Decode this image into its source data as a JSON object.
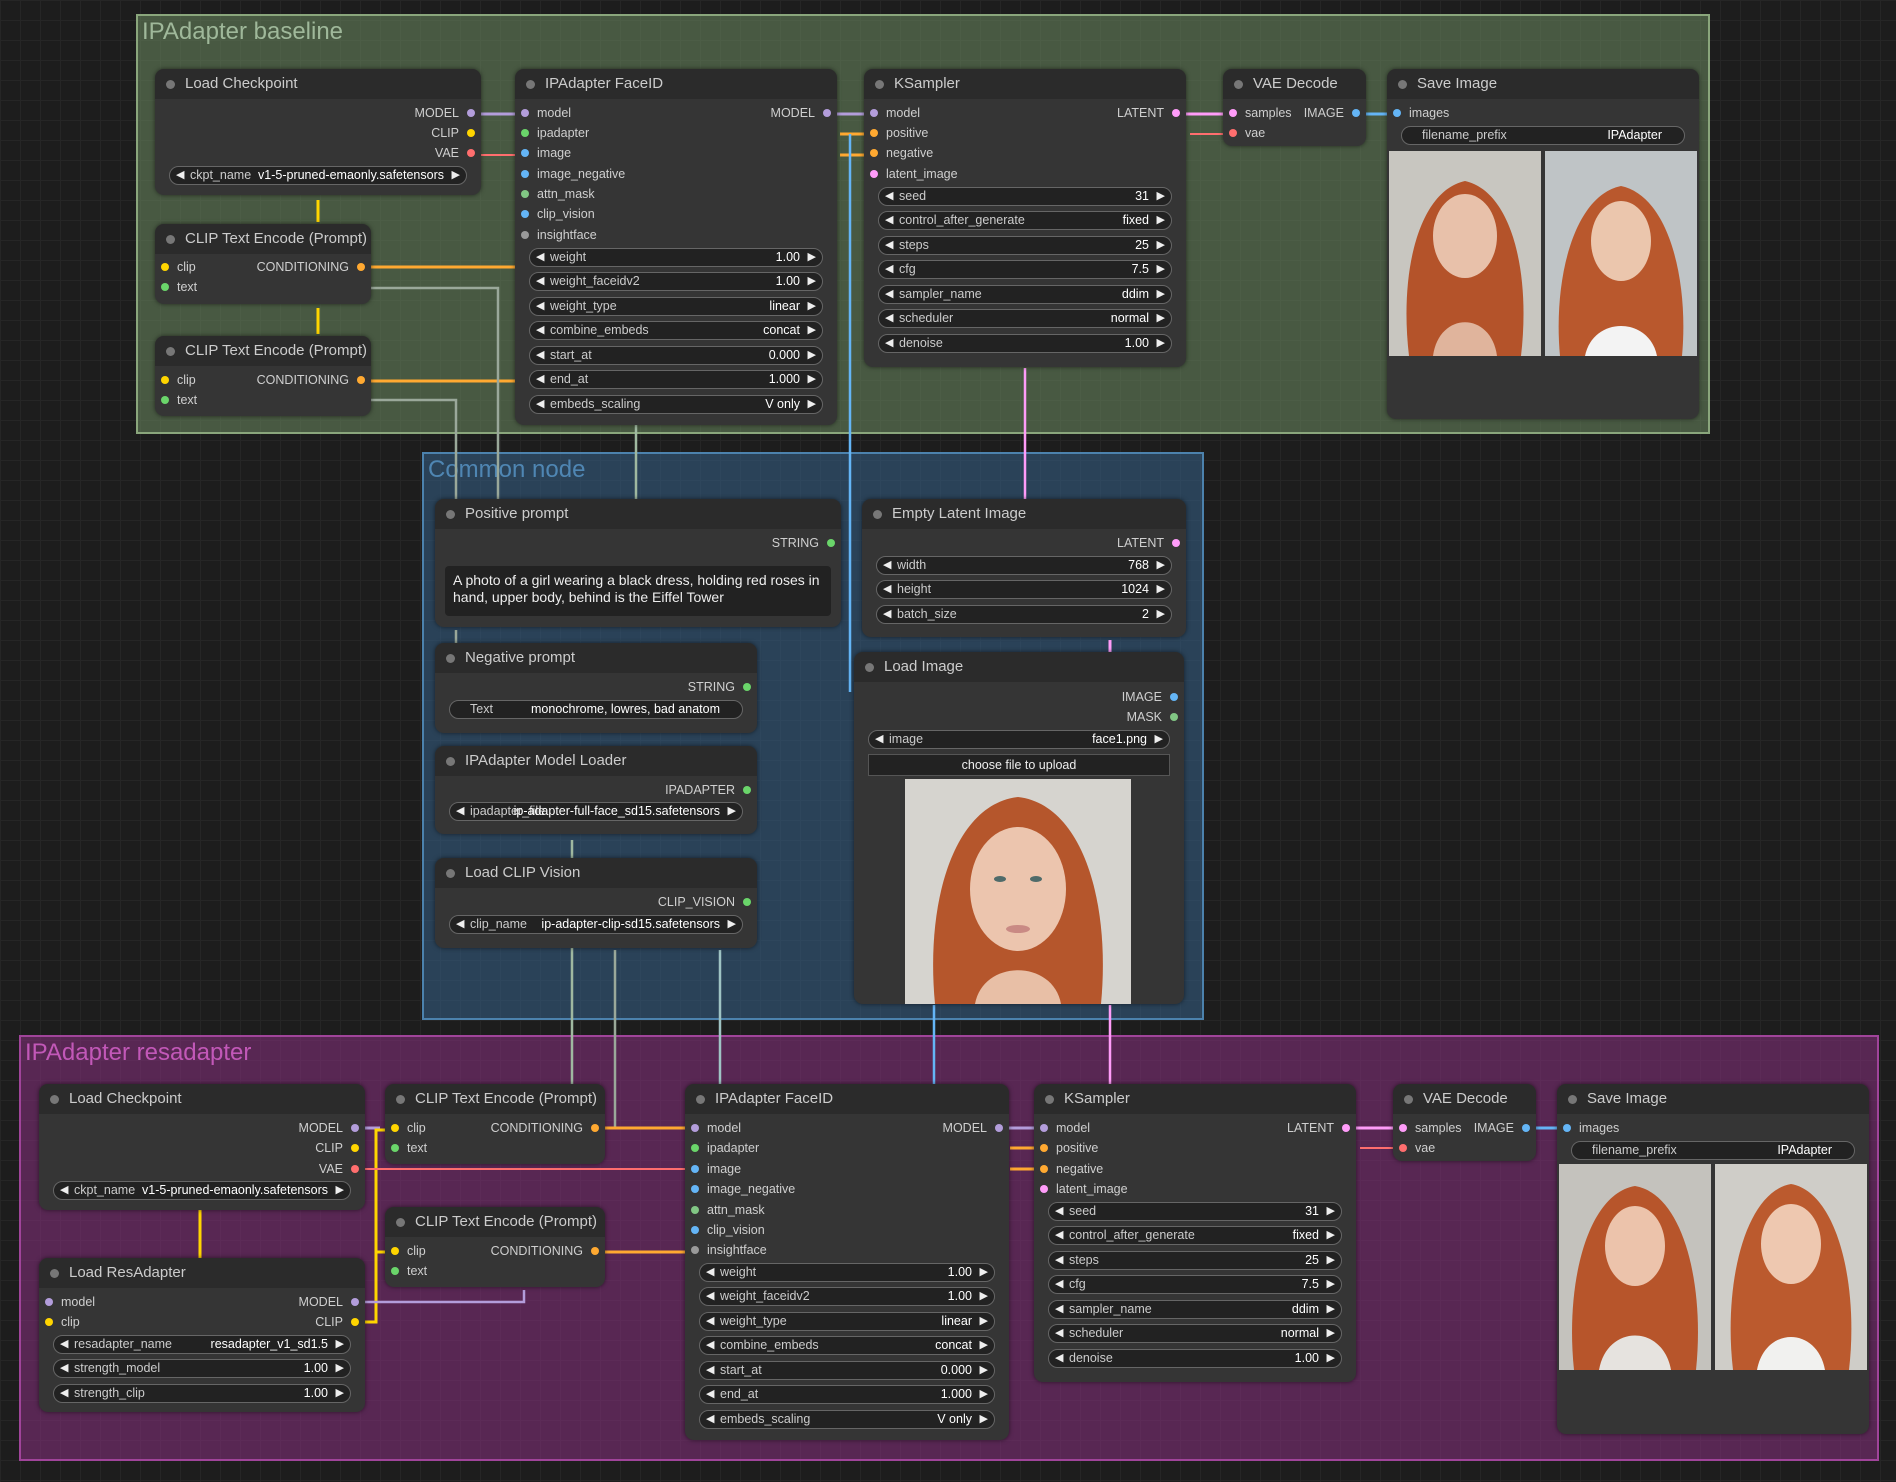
{
  "groups": {
    "baseline": "IPAdapter baseline",
    "common": "Common node",
    "resadapter": "IPAdapter resadapter"
  },
  "colors": {
    "model": "#b39ddb",
    "clip": "#ffd500",
    "vae": "#ff6e6e",
    "conditioning": "#ffa931",
    "image": "#64b5f6",
    "latent": "#ff9cf9",
    "string": "#6ad56a"
  },
  "baseline": {
    "load_checkpoint": {
      "title": "Load Checkpoint",
      "out_model": "MODEL",
      "out_clip": "CLIP",
      "out_vae": "VAE",
      "ckpt_label": "ckpt_name",
      "ckpt_value": "v1-5-pruned-emaonly.safetensors"
    },
    "clip1": {
      "title": "CLIP Text Encode (Prompt)",
      "in_clip": "clip",
      "in_text": "text",
      "out": "CONDITIONING"
    },
    "clip2": {
      "title": "CLIP Text Encode (Prompt)",
      "in_clip": "clip",
      "in_text": "text",
      "out": "CONDITIONING"
    },
    "faceid": {
      "title": "IPAdapter FaceID",
      "inputs": [
        "model",
        "ipadapter",
        "image",
        "image_negative",
        "attn_mask",
        "clip_vision",
        "insightface"
      ],
      "out": "MODEL",
      "widgets": [
        {
          "name": "weight",
          "value": "1.00"
        },
        {
          "name": "weight_faceidv2",
          "value": "1.00"
        },
        {
          "name": "weight_type",
          "value": "linear"
        },
        {
          "name": "combine_embeds",
          "value": "concat"
        },
        {
          "name": "start_at",
          "value": "0.000"
        },
        {
          "name": "end_at",
          "value": "1.000"
        },
        {
          "name": "embeds_scaling",
          "value": "V only"
        }
      ]
    },
    "ksampler": {
      "title": "KSampler",
      "inputs": [
        "model",
        "positive",
        "negative",
        "latent_image"
      ],
      "out": "LATENT",
      "widgets": [
        {
          "name": "seed",
          "value": "31"
        },
        {
          "name": "control_after_generate",
          "value": "fixed"
        },
        {
          "name": "steps",
          "value": "25"
        },
        {
          "name": "cfg",
          "value": "7.5"
        },
        {
          "name": "sampler_name",
          "value": "ddim"
        },
        {
          "name": "scheduler",
          "value": "normal"
        },
        {
          "name": "denoise",
          "value": "1.00"
        }
      ]
    },
    "vae_decode": {
      "title": "VAE Decode",
      "in_samples": "samples",
      "in_vae": "vae",
      "out": "IMAGE"
    },
    "save_image": {
      "title": "Save Image",
      "in_images": "images",
      "prefix_label": "filename_prefix",
      "prefix_value": "IPAdapter"
    }
  },
  "common": {
    "positive": {
      "title": "Positive prompt",
      "out": "STRING",
      "text": "A photo of a girl wearing a black dress, holding red roses in hand, upper body, behind is the Eiffel Tower"
    },
    "negative": {
      "title": "Negative prompt",
      "out": "STRING",
      "label": "Text",
      "value": "monochrome, lowres, bad anatom"
    },
    "model_loader": {
      "title": "IPAdapter Model Loader",
      "out": "IPADAPTER",
      "label": "ipadapter_file",
      "value": "ip-adapter-full-face_sd15.safetensors"
    },
    "clip_vision": {
      "title": "Load CLIP Vision",
      "out": "CLIP_VISION",
      "label": "clip_name",
      "value": "ip-adapter-clip-sd15.safetensors"
    },
    "empty_latent": {
      "title": "Empty Latent Image",
      "out": "LATENT",
      "widgets": [
        {
          "name": "width",
          "value": "768"
        },
        {
          "name": "height",
          "value": "1024"
        },
        {
          "name": "batch_size",
          "value": "2"
        }
      ]
    },
    "load_image": {
      "title": "Load Image",
      "out_image": "IMAGE",
      "out_mask": "MASK",
      "label": "image",
      "value": "face1.png",
      "upload": "choose file to upload"
    }
  },
  "res": {
    "load_checkpoint": {
      "title": "Load Checkpoint",
      "out_model": "MODEL",
      "out_clip": "CLIP",
      "out_vae": "VAE",
      "ckpt_label": "ckpt_name",
      "ckpt_value": "v1-5-pruned-emaonly.safetensors"
    },
    "resadapter": {
      "title": "Load ResAdapter",
      "in_model": "model",
      "in_clip": "clip",
      "out_model": "MODEL",
      "out_clip": "CLIP",
      "widgets": [
        {
          "name": "resadapter_name",
          "value": "resadapter_v1_sd1.5"
        },
        {
          "name": "strength_model",
          "value": "1.00"
        },
        {
          "name": "strength_clip",
          "value": "1.00"
        }
      ]
    },
    "clip1": {
      "title": "CLIP Text Encode (Prompt)",
      "in_clip": "clip",
      "in_text": "text",
      "out": "CONDITIONING"
    },
    "clip2": {
      "title": "CLIP Text Encode (Prompt)",
      "in_clip": "clip",
      "in_text": "text",
      "out": "CONDITIONING"
    },
    "faceid": {
      "title": "IPAdapter FaceID",
      "inputs": [
        "model",
        "ipadapter",
        "image",
        "image_negative",
        "attn_mask",
        "clip_vision",
        "insightface"
      ],
      "out": "MODEL",
      "widgets": [
        {
          "name": "weight",
          "value": "1.00"
        },
        {
          "name": "weight_faceidv2",
          "value": "1.00"
        },
        {
          "name": "weight_type",
          "value": "linear"
        },
        {
          "name": "combine_embeds",
          "value": "concat"
        },
        {
          "name": "start_at",
          "value": "0.000"
        },
        {
          "name": "end_at",
          "value": "1.000"
        },
        {
          "name": "embeds_scaling",
          "value": "V only"
        }
      ]
    },
    "ksampler": {
      "title": "KSampler",
      "inputs": [
        "model",
        "positive",
        "negative",
        "latent_image"
      ],
      "out": "LATENT",
      "widgets": [
        {
          "name": "seed",
          "value": "31"
        },
        {
          "name": "control_after_generate",
          "value": "fixed"
        },
        {
          "name": "steps",
          "value": "25"
        },
        {
          "name": "cfg",
          "value": "7.5"
        },
        {
          "name": "sampler_name",
          "value": "ddim"
        },
        {
          "name": "scheduler",
          "value": "normal"
        },
        {
          "name": "denoise",
          "value": "1.00"
        }
      ]
    },
    "vae_decode": {
      "title": "VAE Decode",
      "in_samples": "samples",
      "in_vae": "vae",
      "out": "IMAGE"
    },
    "save_image": {
      "title": "Save Image",
      "in_images": "images",
      "prefix_label": "filename_prefix",
      "prefix_value": "IPAdapter"
    }
  }
}
